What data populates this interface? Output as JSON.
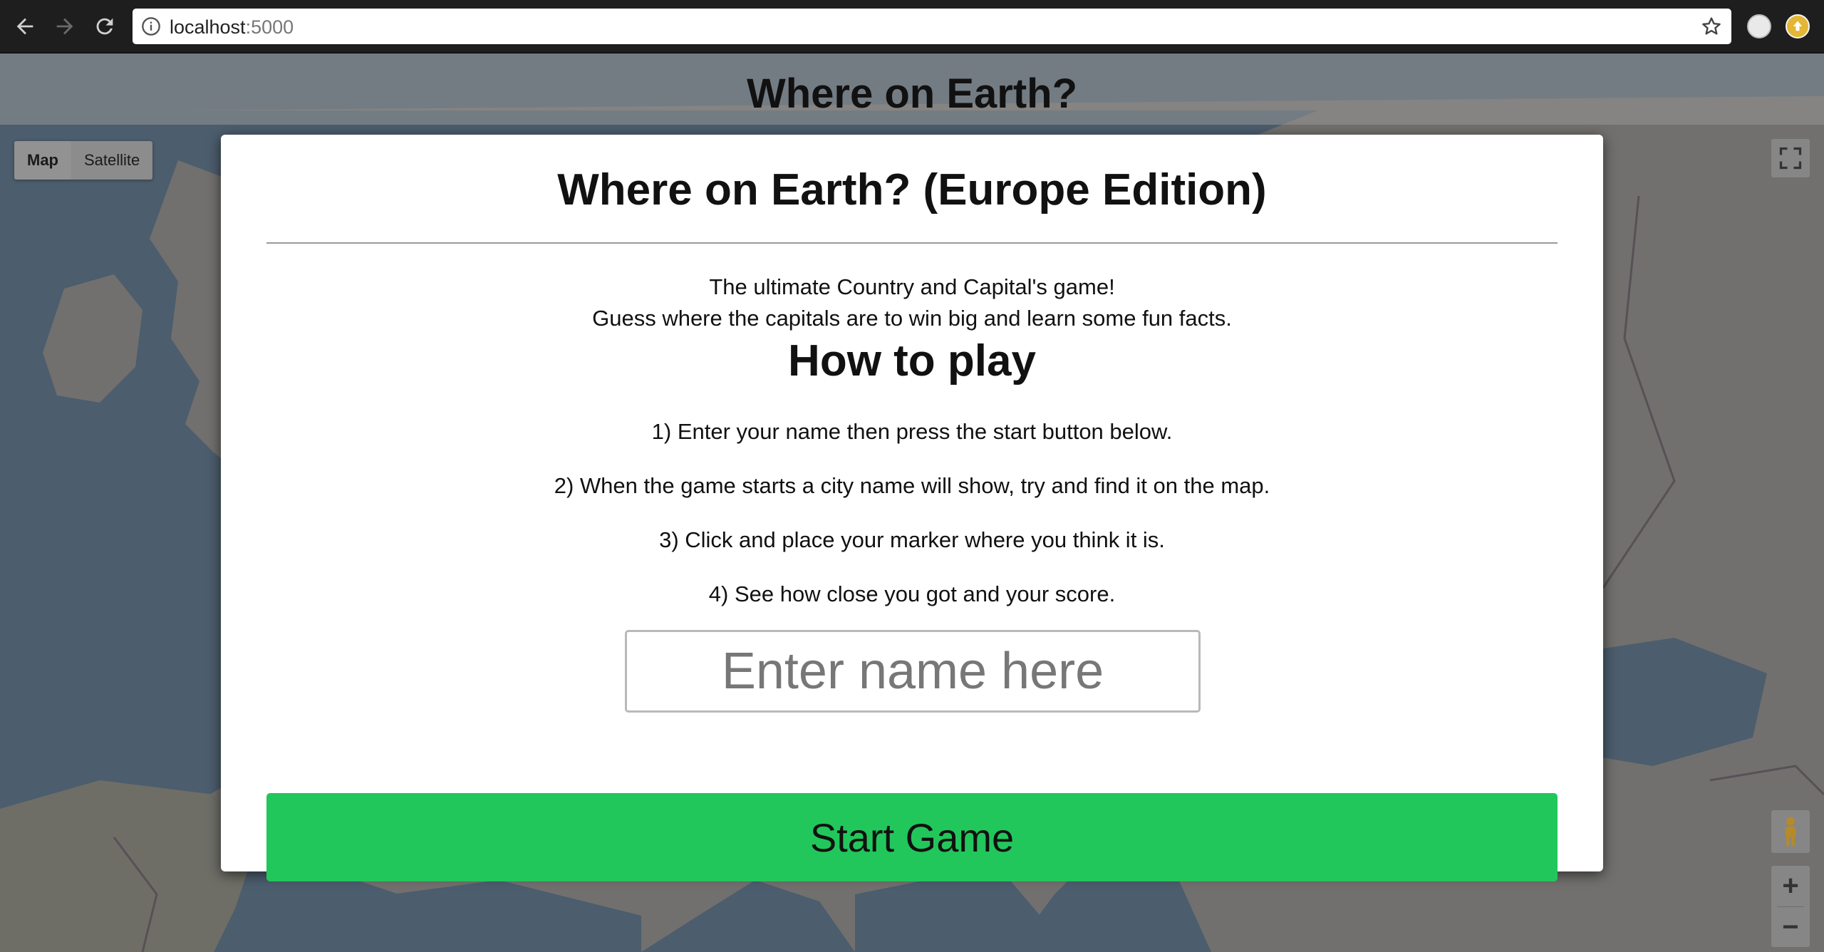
{
  "browser": {
    "url_host": "localhost",
    "url_port": ":5000",
    "icons": {
      "back": "back-arrow-icon",
      "forward": "forward-arrow-icon",
      "reload": "reload-icon",
      "info": "info-icon",
      "bookmark": "star-icon"
    }
  },
  "header": {
    "title": "Where on Earth?"
  },
  "map": {
    "map_type_map": "Map",
    "map_type_satellite": "Satellite",
    "zoom_in": "+",
    "zoom_out": "−"
  },
  "modal": {
    "title": "Where on Earth? (Europe Edition)",
    "intro_line1": "The ultimate Country and Capital's game!",
    "intro_line2": "Guess where the capitals are to win big and learn some fun facts.",
    "how_to_play_title": "How to play",
    "steps": [
      "1) Enter your name then press the start button below.",
      "2) When the game starts a city name will show, try and find it on the map.",
      "3) Click and place your marker where you think it is.",
      "4) See how close you got and your score."
    ],
    "name_placeholder": "Enter name here",
    "start_label": "Start Game"
  },
  "colors": {
    "start_button": "#21c75b",
    "modal_bg": "#ffffff",
    "overlay": "rgba(0,0,0,0.52)"
  }
}
